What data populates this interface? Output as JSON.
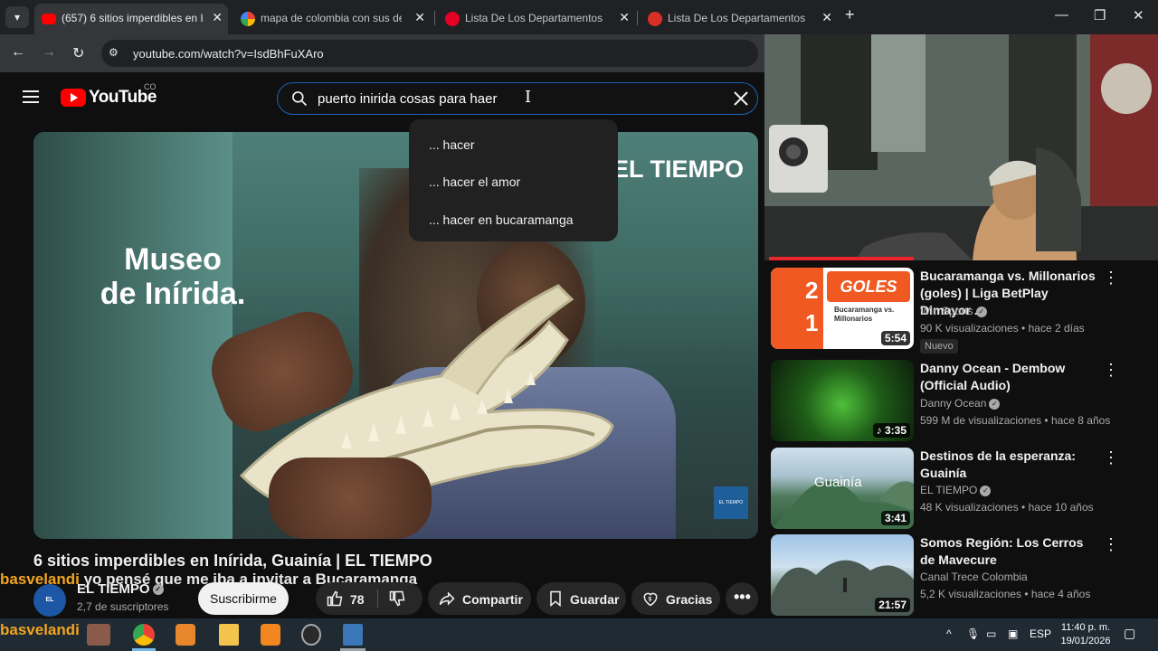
{
  "browser": {
    "tabs": [
      {
        "title": "(657) 6 sitios imperdibles en Iní",
        "active": true,
        "icon": "youtube-icon"
      },
      {
        "title": "mapa de colombia con sus dep",
        "active": false,
        "icon": "google-icon"
      },
      {
        "title": "Lista De Los Departamentos Y C",
        "active": false,
        "icon": "pinterest-icon"
      },
      {
        "title": "Lista De Los Departamentos Y C",
        "active": false,
        "icon": "site-icon"
      }
    ],
    "url": "youtube.com/watch?v=IsdBhFuXAro"
  },
  "youtube": {
    "logo_text": "YouTube",
    "country_code": "CO",
    "search": {
      "value": "puerto inirida cosas para haer",
      "suggestions": [
        "... hacer",
        "... hacer el amor",
        "... hacer en bucaramanga"
      ]
    },
    "video": {
      "overlay_text_1": "Museo",
      "overlay_text_2": "de Inírida.",
      "brand_overlay": "EL TIEMPO",
      "corner_bug": "EL TIEMPO",
      "title": "6 sitios imperdibles en Inírida, Guainía | EL TIEMPO"
    },
    "channel": {
      "avatar_text": "EL TIEMPO",
      "name": "EL TIEMPO",
      "subscribers": "2,7 de suscriptores",
      "subscribe_label": "Suscribirme"
    },
    "actions": {
      "likes": "78",
      "share": "Compartir",
      "save": "Guardar",
      "thanks": "Gracias"
    },
    "recommendations": [
      {
        "title": "Bucaramanga vs. Millonarios (goles) | Liga BetPlay Dimayor ...",
        "channel": "Win Sports",
        "meta": "90 K visualizaciones • hace 2 días",
        "duration": "5:54",
        "badge": "Nuevo",
        "thumb_text": "GOLES",
        "thumb_sub": "Bucaramanga vs. Millonarios",
        "score_a": "2",
        "score_b": "1"
      },
      {
        "title": "Danny Ocean - Dembow (Official Audio)",
        "channel": "Danny Ocean",
        "meta": "599 M de visualizaciones • hace 8 años",
        "duration": "3:35"
      },
      {
        "title": "Destinos de la esperanza: Guainía",
        "channel": "EL TIEMPO",
        "meta": "48 K visualizaciones • hace 10 años",
        "duration": "3:41",
        "thumb_text": "Guainía"
      },
      {
        "title": "Somos Región: Los Cerros de Mavecure",
        "channel": "Canal Trece Colombia",
        "meta": "5,2 K visualizaciones • hace 4 años",
        "duration": "21:57"
      }
    ]
  },
  "stream_chat": {
    "user": "basvelandi",
    "message": " yo pensé que me iba a invitar a Bucaramanga",
    "user2": "basvelandi"
  },
  "taskbar": {
    "language": "ESP",
    "time": "11:40 p. m.",
    "date": "19/01/2026"
  },
  "colors": {
    "youtube_red": "#ff0000",
    "chat_user": "#f3a51d",
    "search_focus": "#1c62b9"
  }
}
